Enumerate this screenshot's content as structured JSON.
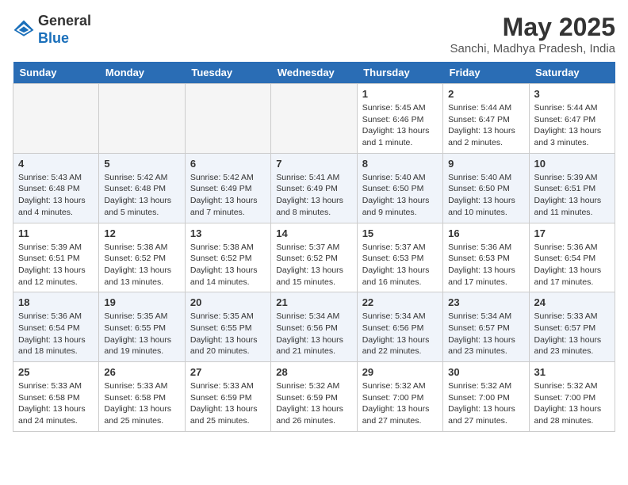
{
  "header": {
    "logo_line1": "General",
    "logo_line2": "Blue",
    "month_year": "May 2025",
    "location": "Sanchi, Madhya Pradesh, India"
  },
  "weekdays": [
    "Sunday",
    "Monday",
    "Tuesday",
    "Wednesday",
    "Thursday",
    "Friday",
    "Saturday"
  ],
  "weeks": [
    [
      {
        "day": "",
        "detail": ""
      },
      {
        "day": "",
        "detail": ""
      },
      {
        "day": "",
        "detail": ""
      },
      {
        "day": "",
        "detail": ""
      },
      {
        "day": "1",
        "detail": "Sunrise: 5:45 AM\nSunset: 6:46 PM\nDaylight: 13 hours and 1 minute."
      },
      {
        "day": "2",
        "detail": "Sunrise: 5:44 AM\nSunset: 6:47 PM\nDaylight: 13 hours and 2 minutes."
      },
      {
        "day": "3",
        "detail": "Sunrise: 5:44 AM\nSunset: 6:47 PM\nDaylight: 13 hours and 3 minutes."
      }
    ],
    [
      {
        "day": "4",
        "detail": "Sunrise: 5:43 AM\nSunset: 6:48 PM\nDaylight: 13 hours and 4 minutes."
      },
      {
        "day": "5",
        "detail": "Sunrise: 5:42 AM\nSunset: 6:48 PM\nDaylight: 13 hours and 5 minutes."
      },
      {
        "day": "6",
        "detail": "Sunrise: 5:42 AM\nSunset: 6:49 PM\nDaylight: 13 hours and 7 minutes."
      },
      {
        "day": "7",
        "detail": "Sunrise: 5:41 AM\nSunset: 6:49 PM\nDaylight: 13 hours and 8 minutes."
      },
      {
        "day": "8",
        "detail": "Sunrise: 5:40 AM\nSunset: 6:50 PM\nDaylight: 13 hours and 9 minutes."
      },
      {
        "day": "9",
        "detail": "Sunrise: 5:40 AM\nSunset: 6:50 PM\nDaylight: 13 hours and 10 minutes."
      },
      {
        "day": "10",
        "detail": "Sunrise: 5:39 AM\nSunset: 6:51 PM\nDaylight: 13 hours and 11 minutes."
      }
    ],
    [
      {
        "day": "11",
        "detail": "Sunrise: 5:39 AM\nSunset: 6:51 PM\nDaylight: 13 hours and 12 minutes."
      },
      {
        "day": "12",
        "detail": "Sunrise: 5:38 AM\nSunset: 6:52 PM\nDaylight: 13 hours and 13 minutes."
      },
      {
        "day": "13",
        "detail": "Sunrise: 5:38 AM\nSunset: 6:52 PM\nDaylight: 13 hours and 14 minutes."
      },
      {
        "day": "14",
        "detail": "Sunrise: 5:37 AM\nSunset: 6:52 PM\nDaylight: 13 hours and 15 minutes."
      },
      {
        "day": "15",
        "detail": "Sunrise: 5:37 AM\nSunset: 6:53 PM\nDaylight: 13 hours and 16 minutes."
      },
      {
        "day": "16",
        "detail": "Sunrise: 5:36 AM\nSunset: 6:53 PM\nDaylight: 13 hours and 17 minutes."
      },
      {
        "day": "17",
        "detail": "Sunrise: 5:36 AM\nSunset: 6:54 PM\nDaylight: 13 hours and 17 minutes."
      }
    ],
    [
      {
        "day": "18",
        "detail": "Sunrise: 5:36 AM\nSunset: 6:54 PM\nDaylight: 13 hours and 18 minutes."
      },
      {
        "day": "19",
        "detail": "Sunrise: 5:35 AM\nSunset: 6:55 PM\nDaylight: 13 hours and 19 minutes."
      },
      {
        "day": "20",
        "detail": "Sunrise: 5:35 AM\nSunset: 6:55 PM\nDaylight: 13 hours and 20 minutes."
      },
      {
        "day": "21",
        "detail": "Sunrise: 5:34 AM\nSunset: 6:56 PM\nDaylight: 13 hours and 21 minutes."
      },
      {
        "day": "22",
        "detail": "Sunrise: 5:34 AM\nSunset: 6:56 PM\nDaylight: 13 hours and 22 minutes."
      },
      {
        "day": "23",
        "detail": "Sunrise: 5:34 AM\nSunset: 6:57 PM\nDaylight: 13 hours and 23 minutes."
      },
      {
        "day": "24",
        "detail": "Sunrise: 5:33 AM\nSunset: 6:57 PM\nDaylight: 13 hours and 23 minutes."
      }
    ],
    [
      {
        "day": "25",
        "detail": "Sunrise: 5:33 AM\nSunset: 6:58 PM\nDaylight: 13 hours and 24 minutes."
      },
      {
        "day": "26",
        "detail": "Sunrise: 5:33 AM\nSunset: 6:58 PM\nDaylight: 13 hours and 25 minutes."
      },
      {
        "day": "27",
        "detail": "Sunrise: 5:33 AM\nSunset: 6:59 PM\nDaylight: 13 hours and 25 minutes."
      },
      {
        "day": "28",
        "detail": "Sunrise: 5:32 AM\nSunset: 6:59 PM\nDaylight: 13 hours and 26 minutes."
      },
      {
        "day": "29",
        "detail": "Sunrise: 5:32 AM\nSunset: 7:00 PM\nDaylight: 13 hours and 27 minutes."
      },
      {
        "day": "30",
        "detail": "Sunrise: 5:32 AM\nSunset: 7:00 PM\nDaylight: 13 hours and 27 minutes."
      },
      {
        "day": "31",
        "detail": "Sunrise: 5:32 AM\nSunset: 7:00 PM\nDaylight: 13 hours and 28 minutes."
      }
    ]
  ]
}
